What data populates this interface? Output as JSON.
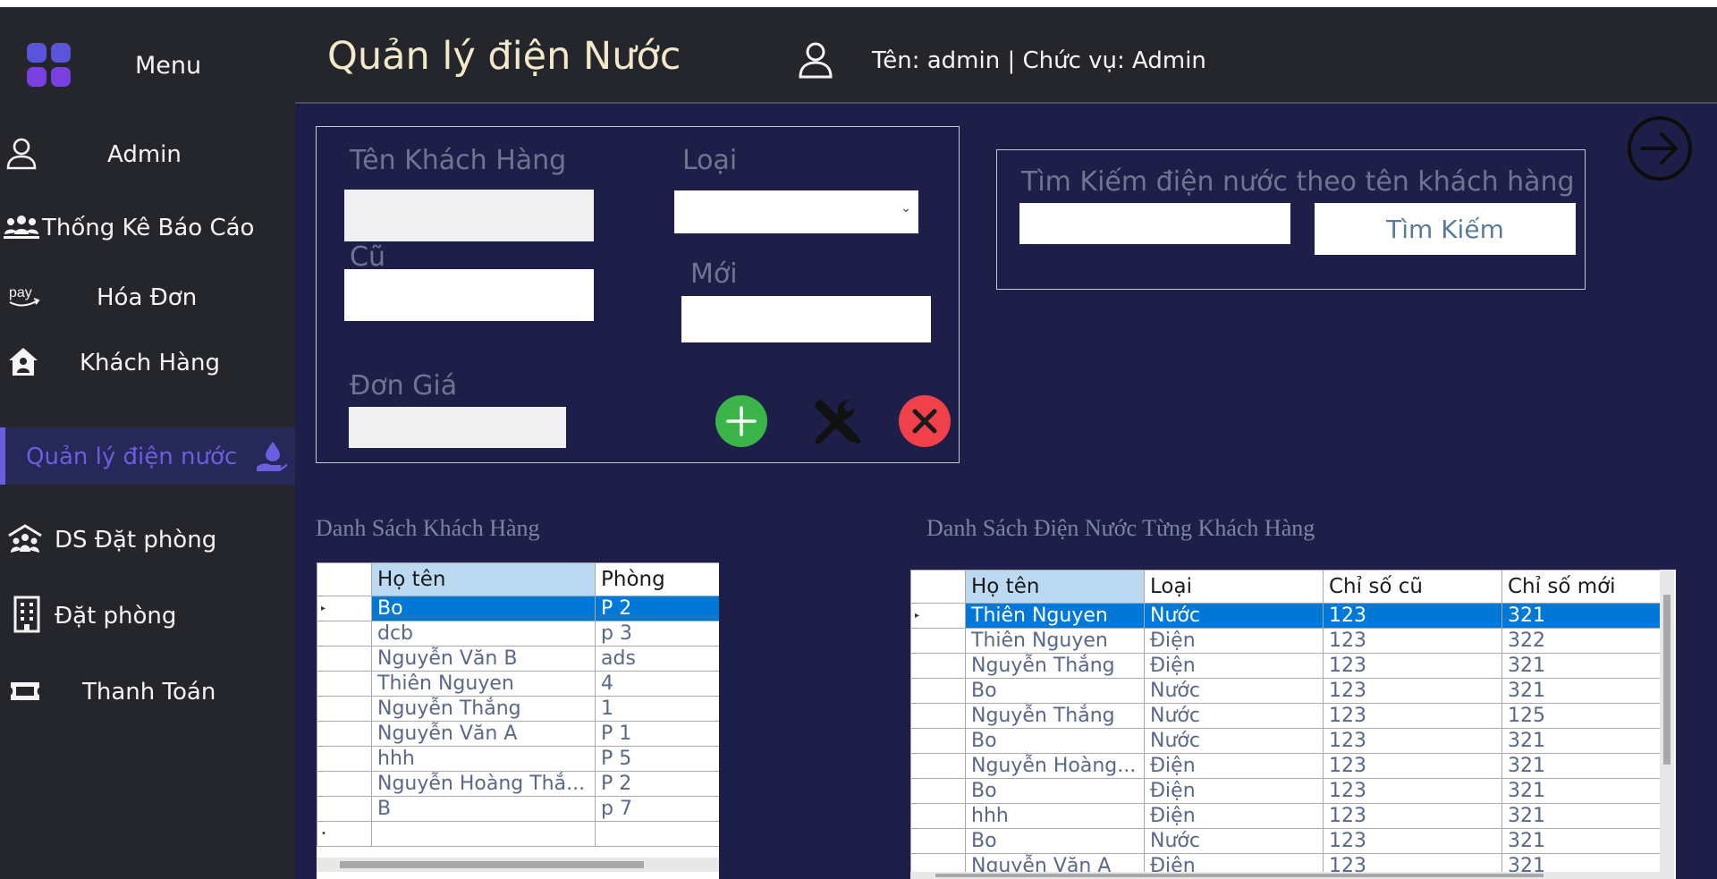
{
  "header": {
    "title": "Quản lý điện Nước",
    "user_info": "Tên: admin | Chức vụ: Admin"
  },
  "sidebar": {
    "menu_label": "Menu",
    "accent_color": "#6b5fe0",
    "items": [
      {
        "label": "Admin",
        "icon": "user-icon"
      },
      {
        "label": "Thống Kê Báo Cáo",
        "icon": "users-group-icon"
      },
      {
        "label": "Hóa Đơn",
        "icon": "pay-icon"
      },
      {
        "label": "Khách Hàng",
        "icon": "house-user-icon"
      },
      {
        "label": "Quản lý điện nước",
        "icon": "hand-water-drop-icon",
        "active": true
      },
      {
        "label": "DS Đặt phòng",
        "icon": "people-roof-icon"
      },
      {
        "label": "Đặt phòng",
        "icon": "building-icon"
      },
      {
        "label": "Thanh Toán",
        "icon": "ticket-icon"
      }
    ]
  },
  "form": {
    "customer_name_label": "Tên Khách Hàng",
    "customer_name_value": "",
    "type_label": "Loại",
    "type_value": "",
    "old_label": "Cũ",
    "old_value": "",
    "new_label": "Mới",
    "new_value": "",
    "unit_price_label": "Đơn Giá",
    "unit_price_value": "",
    "add_color": "#3bb54a",
    "delete_color": "#f0404a"
  },
  "search": {
    "label": "Tìm Kiếm điện nước theo tên khách hàng",
    "value": "",
    "button_label": "Tìm Kiếm"
  },
  "customers": {
    "title": "Danh Sách Khách Hàng",
    "columns": [
      "Họ tên",
      "Phòng"
    ],
    "rows": [
      [
        "Bo",
        "P 2"
      ],
      [
        "dcb",
        "p 3"
      ],
      [
        "Nguyễn Văn B",
        "ads"
      ],
      [
        "Thiên Nguyen",
        "4"
      ],
      [
        "Nguyễn Thắng",
        "1"
      ],
      [
        "Nguyễn Văn A",
        "P 1"
      ],
      [
        "hhh",
        "P 5"
      ],
      [
        "Nguyễn Hoàng Thắ...",
        "P 2"
      ],
      [
        "B",
        "p 7"
      ]
    ]
  },
  "utilities": {
    "title": "Danh Sách Điện Nước Từng Khách Hàng",
    "columns": [
      "Họ tên",
      "Loại",
      "Chỉ số cũ",
      "Chỉ số mới"
    ],
    "rows": [
      [
        "Thiên Nguyen",
        "Nước",
        "123",
        "321"
      ],
      [
        "Thiên Nguyen",
        "Điện",
        "123",
        "322"
      ],
      [
        "Nguyễn Thắng",
        "Điện",
        "123",
        "321"
      ],
      [
        "Bo",
        "Nước",
        "123",
        "321"
      ],
      [
        "Nguyễn Thắng",
        "Nước",
        "123",
        "125"
      ],
      [
        "Bo",
        "Nước",
        "123",
        "321"
      ],
      [
        "Nguyễn Hoàng...",
        "Điện",
        "123",
        "321"
      ],
      [
        "Bo",
        "Điện",
        "123",
        "321"
      ],
      [
        "hhh",
        "Điện",
        "123",
        "321"
      ],
      [
        "Bo",
        "Nước",
        "123",
        "321"
      ],
      [
        "Nguyễn Văn A",
        "Điện",
        "123",
        "321"
      ]
    ]
  }
}
